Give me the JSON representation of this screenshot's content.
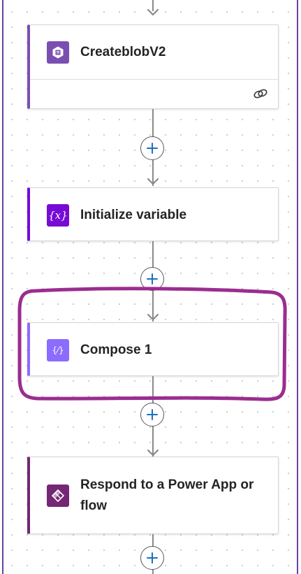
{
  "flow": {
    "steps": [
      {
        "title": "CreateblobV2",
        "icon": "blob-storage-icon",
        "accent": "#7b4fb1",
        "has_footer": true,
        "footer_icon": "link-icon"
      },
      {
        "title": "Initialize variable",
        "icon": "variable-icon",
        "accent": "#770bd6"
      },
      {
        "title": "Compose 1",
        "icon": "compose-icon",
        "accent": "#8c6cff"
      },
      {
        "title": "Respond to a Power App or flow",
        "icon": "power-apps-icon",
        "accent": "#742774"
      }
    ],
    "add_step_icon": "plus-icon",
    "highlight_color": "#9b2d8f"
  }
}
